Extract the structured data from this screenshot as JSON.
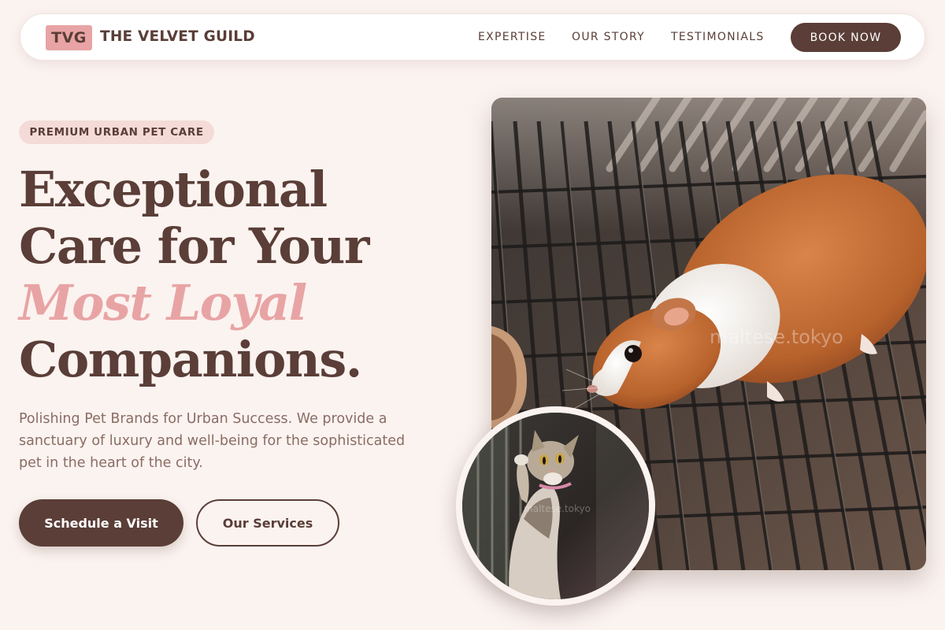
{
  "nav": {
    "logo_mark": "TVG",
    "brand_name": "THE VELVET GUILD",
    "links": [
      "EXPERTISE",
      "OUR STORY",
      "TESTIMONIALS"
    ],
    "cta": "BOOK NOW"
  },
  "hero": {
    "badge": "PREMIUM URBAN PET CARE",
    "headline_part1": "Exceptional Care for Your",
    "headline_accent": "Most Loyal",
    "headline_part2": "Companions.",
    "lede": "Polishing Pet Brands for Urban Success. We provide a sanctuary of luxury and well-being for the sophisticated pet in the heart of the city.",
    "primary_cta": "Schedule a Visit",
    "secondary_cta": "Our Services"
  },
  "images": {
    "main_watermark": "maltese.tokyo",
    "circle_watermark": "maltese.tokyo"
  },
  "colors": {
    "background": "#fbf3f0",
    "brand_brown": "#5a3e37",
    "accent_pink": "#e8a4a4",
    "badge_bg": "#f4dbd8"
  }
}
